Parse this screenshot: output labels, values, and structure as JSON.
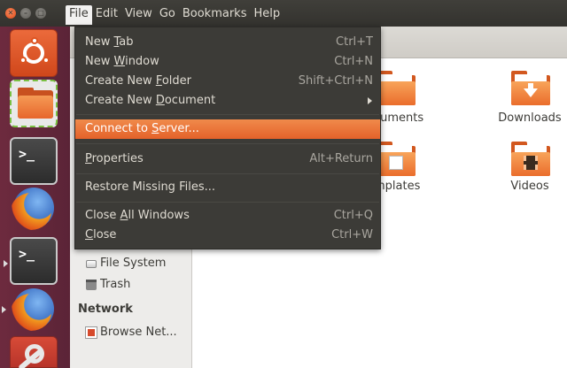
{
  "menubar": {
    "items": [
      "File",
      "Edit",
      "View",
      "Go",
      "Bookmarks",
      "Help"
    ],
    "active": "File"
  },
  "file_menu": {
    "items": [
      {
        "label_pre": "New ",
        "mnemonic": "T",
        "label_post": "ab",
        "shortcut": "Ctrl+T"
      },
      {
        "label_pre": "New ",
        "mnemonic": "W",
        "label_post": "indow",
        "shortcut": "Ctrl+N"
      },
      {
        "label_pre": "Create New ",
        "mnemonic": "F",
        "label_post": "older",
        "shortcut": "Shift+Ctrl+N"
      },
      {
        "label_pre": "Create New ",
        "mnemonic": "D",
        "label_post": "ocument",
        "shortcut": ""
      },
      {
        "label_pre": "Connect to ",
        "mnemonic": "S",
        "label_post": "erver...",
        "shortcut": ""
      },
      {
        "label_pre": "",
        "mnemonic": "P",
        "label_post": "roperties",
        "shortcut": "Alt+Return"
      },
      {
        "label_pre": "Restore Missing Files...",
        "mnemonic": "",
        "label_post": "",
        "shortcut": ""
      },
      {
        "label_pre": "Close ",
        "mnemonic": "A",
        "label_post": "ll Windows",
        "shortcut": "Ctrl+Q"
      },
      {
        "label_pre": "",
        "mnemonic": "C",
        "label_post": "lose",
        "shortcut": "Ctrl+W"
      }
    ],
    "highlighted_index": 4
  },
  "sidebar": {
    "devices": [
      {
        "label": "File System",
        "icon": "drive-icon"
      },
      {
        "label": "Trash",
        "icon": "trash-icon"
      }
    ],
    "network_heading": "Network",
    "network": [
      {
        "label": "Browse Net...",
        "icon": "network-icon"
      }
    ]
  },
  "folders": [
    {
      "label": "cuments",
      "icon": "documents-folder-icon"
    },
    {
      "label": "Downloads",
      "icon": "downloads-folder-icon"
    },
    {
      "label": "mplates",
      "icon": "templates-folder-icon"
    },
    {
      "label": "Videos",
      "icon": "videos-folder-icon"
    }
  ],
  "colors": {
    "menu_bg": "#3c3b37",
    "highlight": "#e9703a",
    "launcher": "#652839",
    "folder_orange": "#e7662c"
  }
}
